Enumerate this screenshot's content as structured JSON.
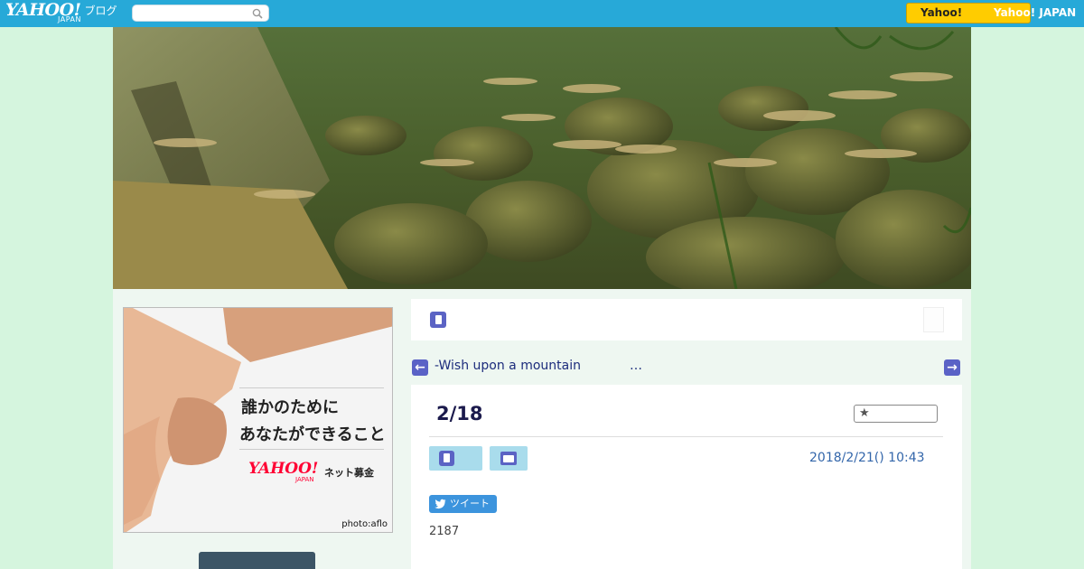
{
  "header": {
    "logo": "YAHOO!",
    "logo_sub": "JAPAN",
    "logo_blog": "ブログ",
    "search": {
      "value": "",
      "placeholder": ""
    },
    "yahoo_button_label": "Yahoo!",
    "yahoo_japan_link": "Yahoo! JAPAN",
    "colors": {
      "bar": "#27a9d8",
      "button": "#ffcc00"
    }
  },
  "hero": {
    "alt": "underwater stream with fish and mossy rocks"
  },
  "sidebar": {
    "ad": {
      "line1": "誰かのために",
      "line2": "あなたができること",
      "logo": "YAHOO!",
      "logo_sub": "JAPAN",
      "tag": "ネット募金",
      "credit": "photo:aflo"
    }
  },
  "nav": {
    "icon": "book-icon"
  },
  "pager": {
    "prev_label": "←",
    "next_label": "→",
    "link_text": "-Wish upon a mountain",
    "ellipsis": "…"
  },
  "article": {
    "title": "2/18",
    "fav_icon": "star-icon",
    "date": "2018/2/21()  10:43",
    "tweet_label": "ツイート",
    "body": "2187"
  }
}
